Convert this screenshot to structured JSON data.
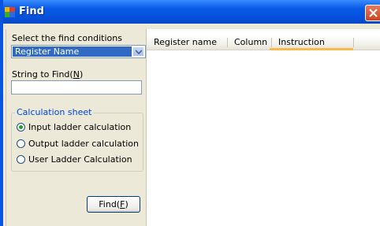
{
  "window": {
    "title": "Find"
  },
  "conditions": {
    "label": "Select the find conditions",
    "selected": "Register Name"
  },
  "search": {
    "label": "String to Find(",
    "label_mnemonic": "N",
    "label_suffix": ")",
    "value": ""
  },
  "calculation": {
    "legend": "Calculation sheet",
    "options": [
      {
        "label": "Input ladder calculation",
        "selected": true
      },
      {
        "label": "Output ladder calculation",
        "selected": false
      },
      {
        "label": "User Ladder Calculation",
        "selected": false
      }
    ]
  },
  "find_button": {
    "label": "Find(",
    "mnemonic": "F",
    "suffix": ")"
  },
  "results": {
    "columns": [
      "Register name",
      "Column",
      "Instruction"
    ],
    "rows": []
  }
}
